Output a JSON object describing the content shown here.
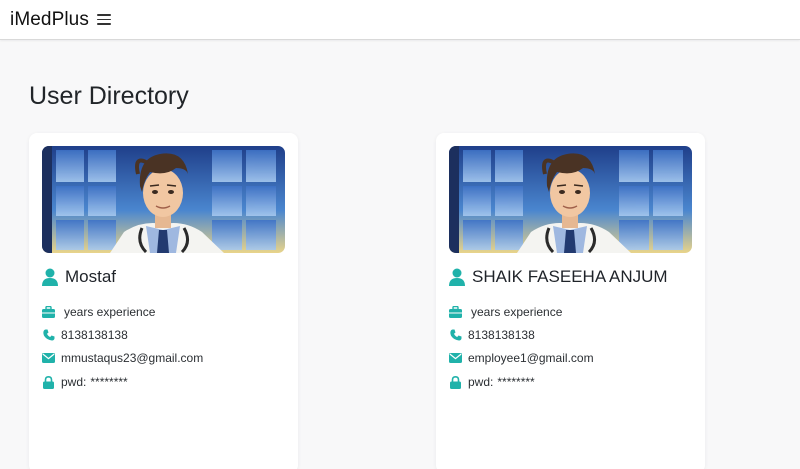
{
  "app": {
    "brand": "iMedPlus"
  },
  "page": {
    "title": "User Directory"
  },
  "colors": {
    "accent": "#20b2aa",
    "background": "#f8f8f9",
    "card": "#ffffff"
  },
  "users": [
    {
      "name": "Mostaf",
      "experience": " years experience",
      "phone": "8138138138",
      "email": "mmustaqus23@gmail.com",
      "pwd_label": "pwd:",
      "pwd": "********"
    },
    {
      "name": "SHAIK FASEEHA ANJUM",
      "experience": " years experience",
      "phone": "8138138138",
      "email": "employee1@gmail.com",
      "pwd_label": "pwd:",
      "pwd": "********"
    }
  ],
  "icons": {
    "name": "user-icon",
    "experience": "briefcase-icon",
    "phone": "phone-icon",
    "email": "envelope-icon",
    "password": "lock-icon",
    "menu": "hamburger-icon"
  }
}
